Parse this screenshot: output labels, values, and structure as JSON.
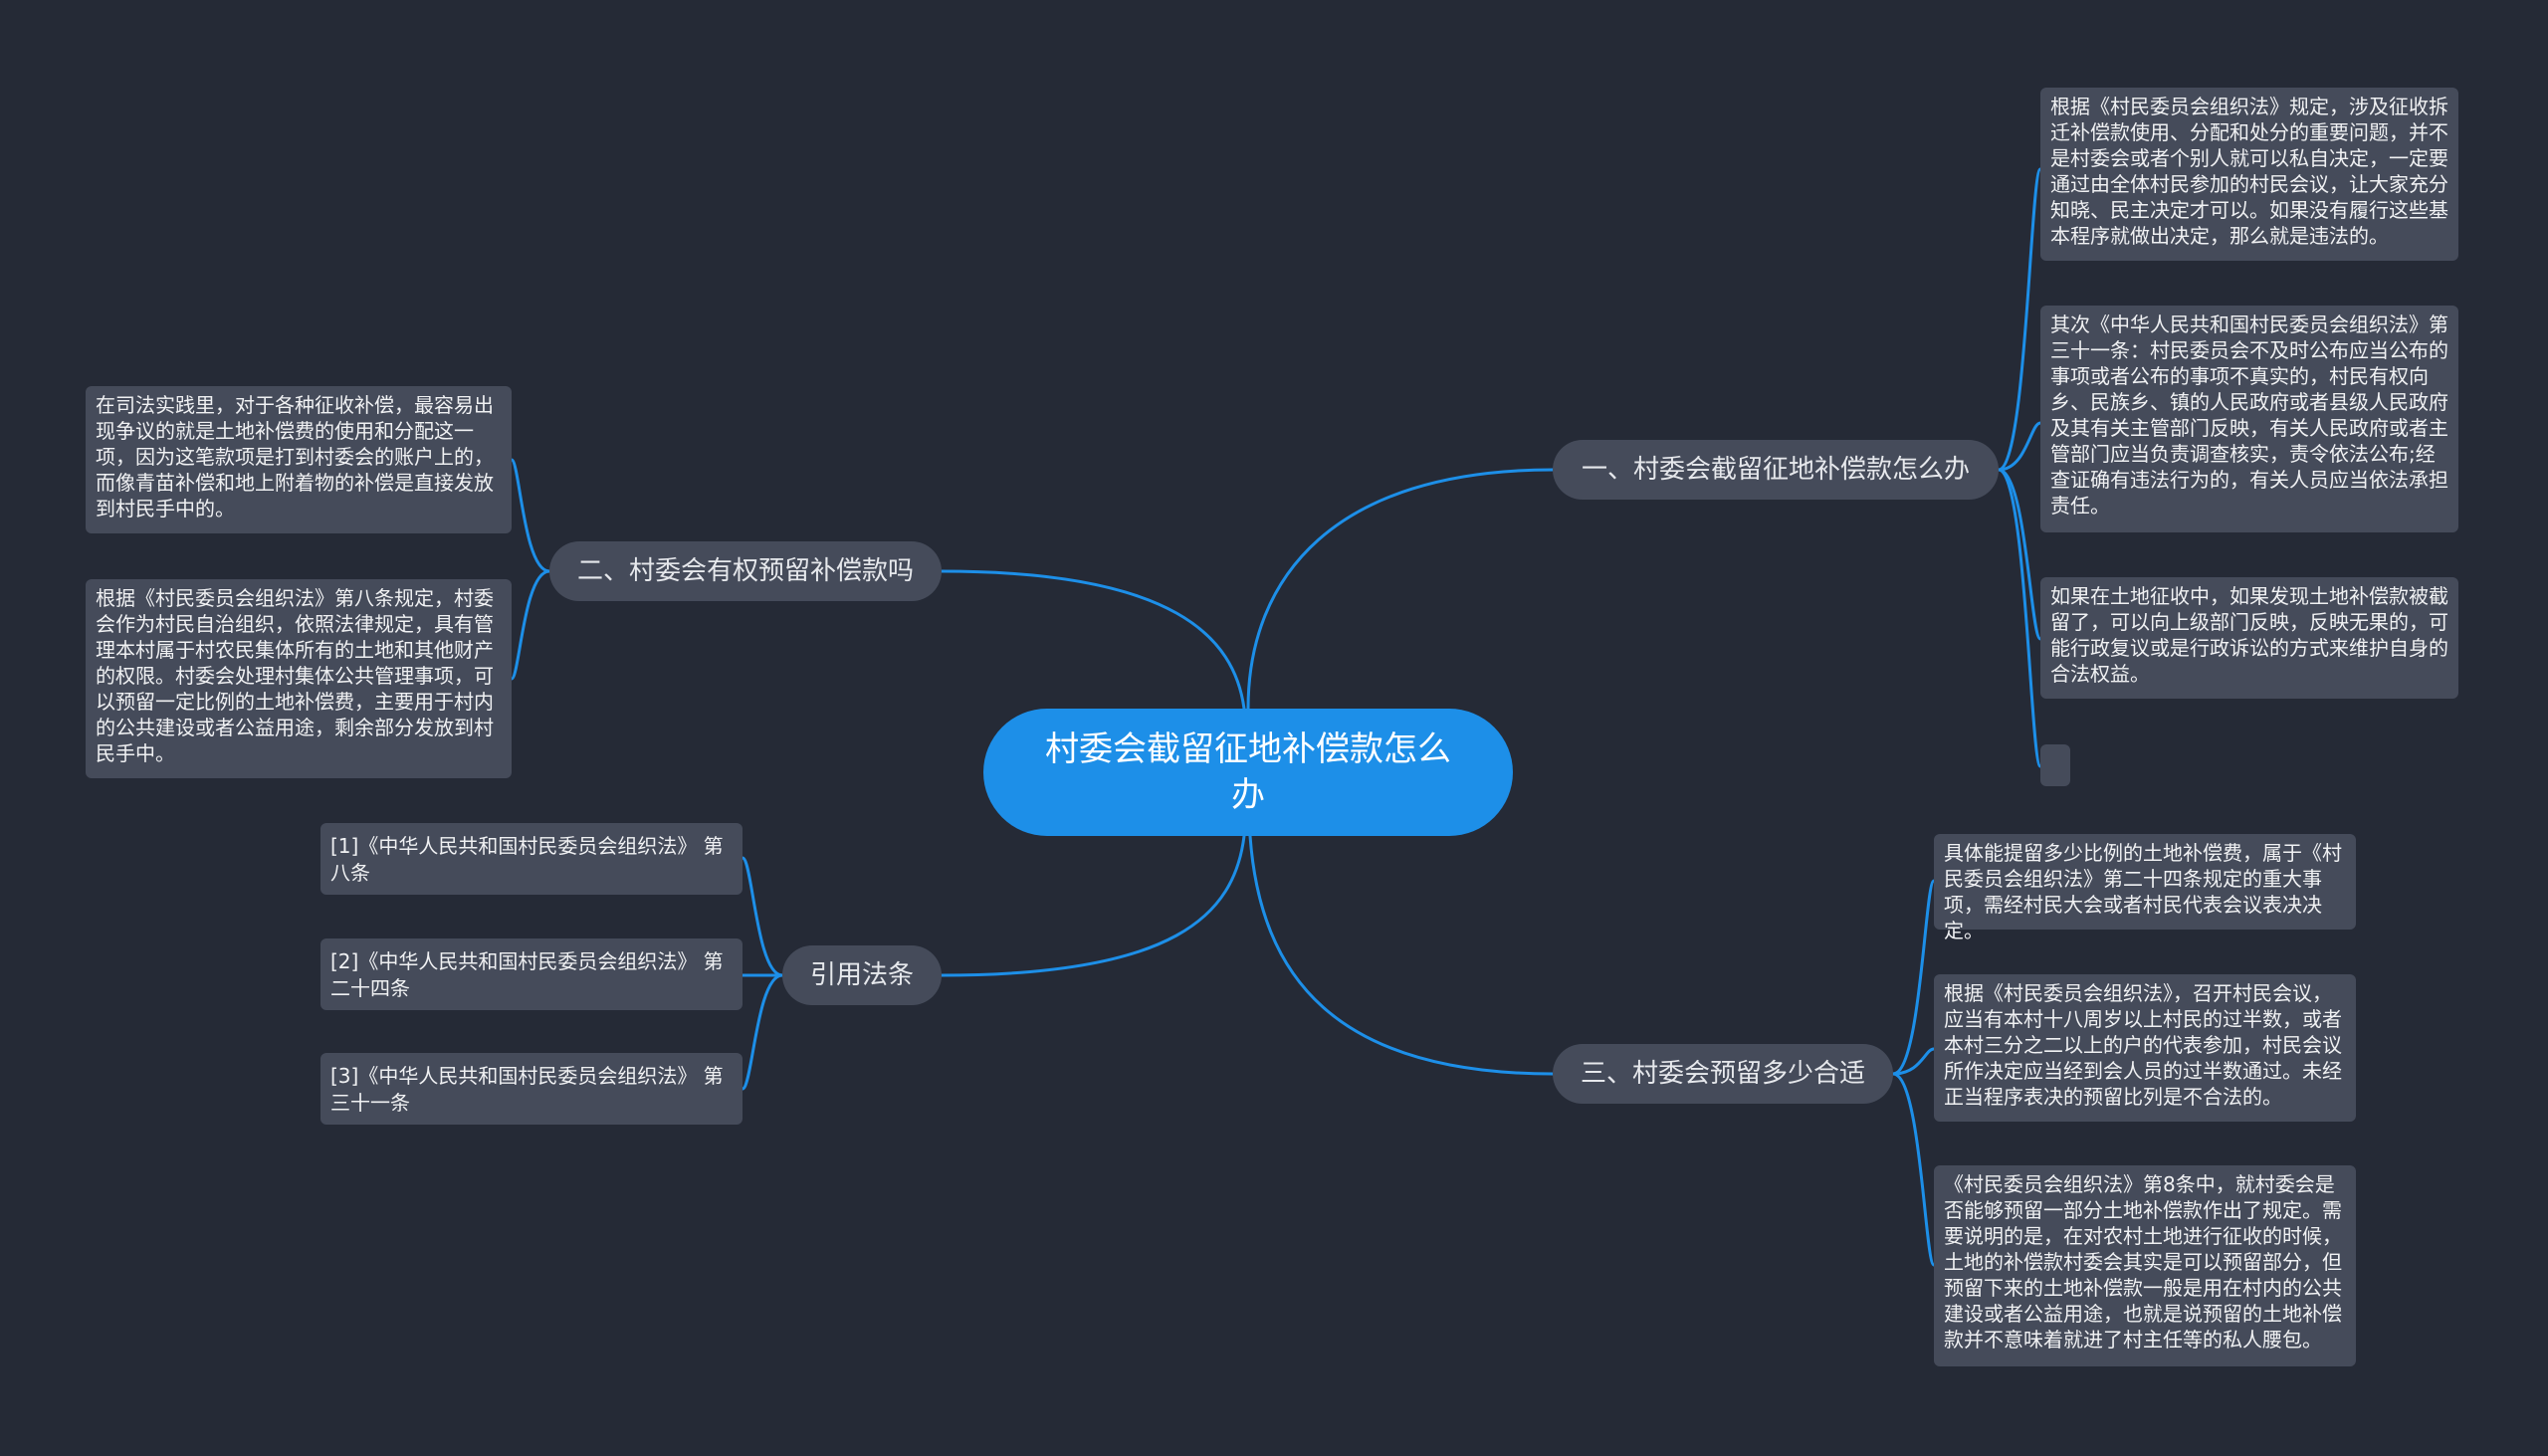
{
  "root": {
    "title": "村委会截留征地补偿款怎么办"
  },
  "branches": {
    "b1": {
      "label": "一、村委会截留征地补偿款怎么办",
      "leaves": [
        "根据《村民委员会组织法》规定，涉及征收拆迁补偿款使用、分配和处分的重要问题，并不是村委会或者个别人就可以私自决定，一定要通过由全体村民参加的村民会议，让大家充分知晓、民主决定才可以。如果没有履行这些基本程序就做出决定，那么就是违法的。",
        "其次《中华人民共和国村民委员会组织法》第三十一条：村民委员会不及时公布应当公布的事项或者公布的事项不真实的，村民有权向乡、民族乡、镇的人民政府或者县级人民政府及其有关主管部门反映，有关人民政府或者主管部门应当负责调查核实，责令依法公布;经查证确有违法行为的，有关人员应当依法承担责任。",
        "如果在土地征收中，如果发现土地补偿款被截留了，可以向上级部门反映，反映无果的，可能行政复议或是行政诉讼的方式来维护自身的合法权益。"
      ]
    },
    "b2": {
      "label": "二、村委会有权预留补偿款吗",
      "leaves": [
        "在司法实践里，对于各种征收补偿，最容易出现争议的就是土地补偿费的使用和分配这一项，因为这笔款项是打到村委会的账户上的，而像青苗补偿和地上附着物的补偿是直接发放到村民手中的。",
        "根据《村民委员会组织法》第八条规定，村委会作为村民自治组织，依照法律规定，具有管理本村属于村农民集体所有的土地和其他财产的权限。村委会处理村集体公共管理事项，可以预留一定比例的土地补偿费，主要用于村内的公共建设或者公益用途，剩余部分发放到村民手中。"
      ]
    },
    "b3": {
      "label": "三、村委会预留多少合适",
      "leaves": [
        "具体能提留多少比例的土地补偿费，属于《村民委员会组织法》第二十四条规定的重大事项，需经村民大会或者村民代表会议表决决定。",
        "根据《村民委员会组织法》，召开村民会议，应当有本村十八周岁以上村民的过半数，或者本村三分之二以上的户的代表参加，村民会议所作决定应当经到会人员的过半数通过。未经正当程序表决的预留比列是不合法的。",
        "《村民委员会组织法》第8条中，就村委会是否能够预留一部分土地补偿款作出了规定。需要说明的是，在对农村土地进行征收的时候，土地的补偿款村委会其实是可以预留部分，但预留下来的土地补偿款一般是用在村内的公共建设或者公益用途，也就是说预留的土地补偿款并不意味着就进了村主任等的私人腰包。"
      ]
    },
    "b4": {
      "label": "引用法条",
      "leaves": [
        "[1]《中华人民共和国村民委员会组织法》 第八条",
        "[2]《中华人民共和国村民委员会组织法》 第二十四条",
        "[3]《中华人民共和国村民委员会组织法》 第三十一条"
      ]
    }
  },
  "colors": {
    "background": "#252a36",
    "root": "#1d8fe8",
    "node": "#454b5a",
    "link": "#1d8fe8"
  }
}
